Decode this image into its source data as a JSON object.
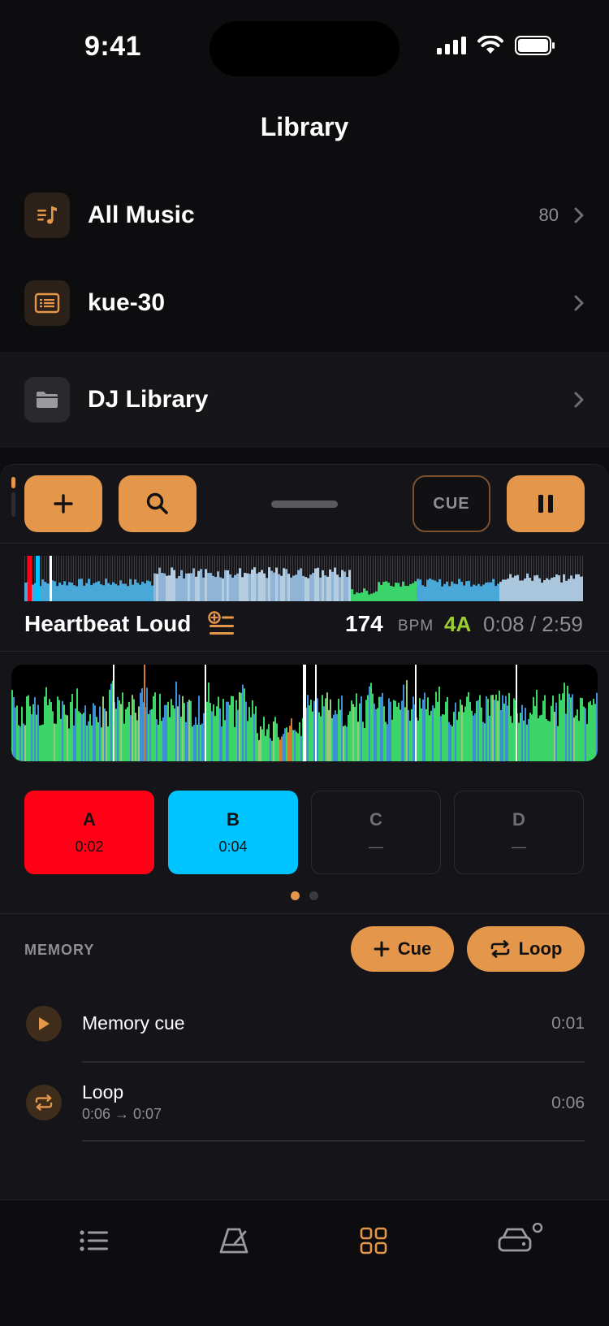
{
  "status": {
    "time": "9:41"
  },
  "header": {
    "title": "Library"
  },
  "library": {
    "items": [
      {
        "label": "All Music",
        "count": "80",
        "icon": "music-list-icon"
      },
      {
        "label": "kue-30",
        "count": "",
        "icon": "playlist-icon"
      },
      {
        "label": "DJ Library",
        "count": "",
        "icon": "folder-icon"
      }
    ]
  },
  "player": {
    "cue_label": "CUE",
    "track_title": "Heartbeat Loud",
    "bpm": "174",
    "bpm_unit": "BPM",
    "key": "4A",
    "time": "0:08 / 2:59",
    "progress": 0.045
  },
  "hotcues": [
    {
      "letter": "A",
      "time": "0:02",
      "color": "#ff0016"
    },
    {
      "letter": "B",
      "time": "0:04",
      "color": "#00c4ff"
    },
    {
      "letter": "C",
      "time": "—",
      "color": ""
    },
    {
      "letter": "D",
      "time": "—",
      "color": ""
    }
  ],
  "memory": {
    "label": "MEMORY",
    "add_cue": "Cue",
    "add_loop": "Loop",
    "items": [
      {
        "title": "Memory cue",
        "sub": "",
        "time": "0:01",
        "icon": "play-icon"
      },
      {
        "title": "Loop",
        "sub": "0:06 → 0:07",
        "time": "0:06",
        "icon": "loop-icon"
      }
    ]
  },
  "colors": {
    "accent": "#e4964a",
    "key": "#9acd32"
  }
}
